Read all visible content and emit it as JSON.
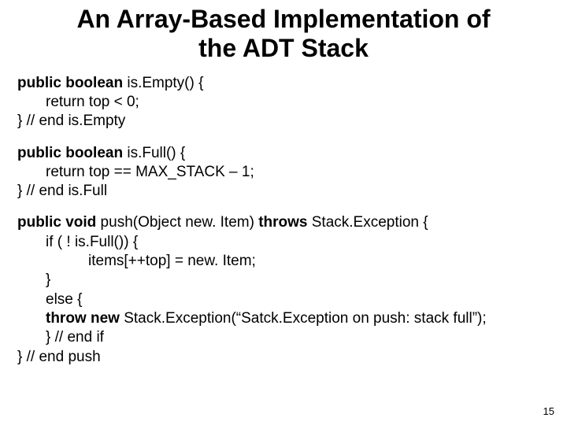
{
  "title_line1": "An Array-Based Implementation of",
  "title_line2": "the ADT Stack",
  "isEmpty": {
    "sig_kw": "public boolean",
    "sig_rest": " is.Empty() {",
    "body": "return top < 0;",
    "close": "}   // end is.Empty"
  },
  "isFull": {
    "sig_kw": "public boolean",
    "sig_rest": " is.Full() {",
    "body": "return top == MAX_STACK – 1;",
    "close": "} // end is.Full"
  },
  "push": {
    "sig_kw1": "public void",
    "sig_mid": " push(Object new. Item) ",
    "sig_kw2": "throws",
    "sig_rest2": " Stack.Exception {",
    "if_line": "if ( ! is.Full()) {",
    "assign": "items[++top] = new. Item;",
    "close_if": "}",
    "else_line": "else {",
    "throw_kw": "throw new",
    "throw_rest": " Stack.Exception(“Satck.Exception on push: stack full”);",
    "close_else": "}      // end if",
    "close_method": "}    // end push"
  },
  "pagenum": "15"
}
